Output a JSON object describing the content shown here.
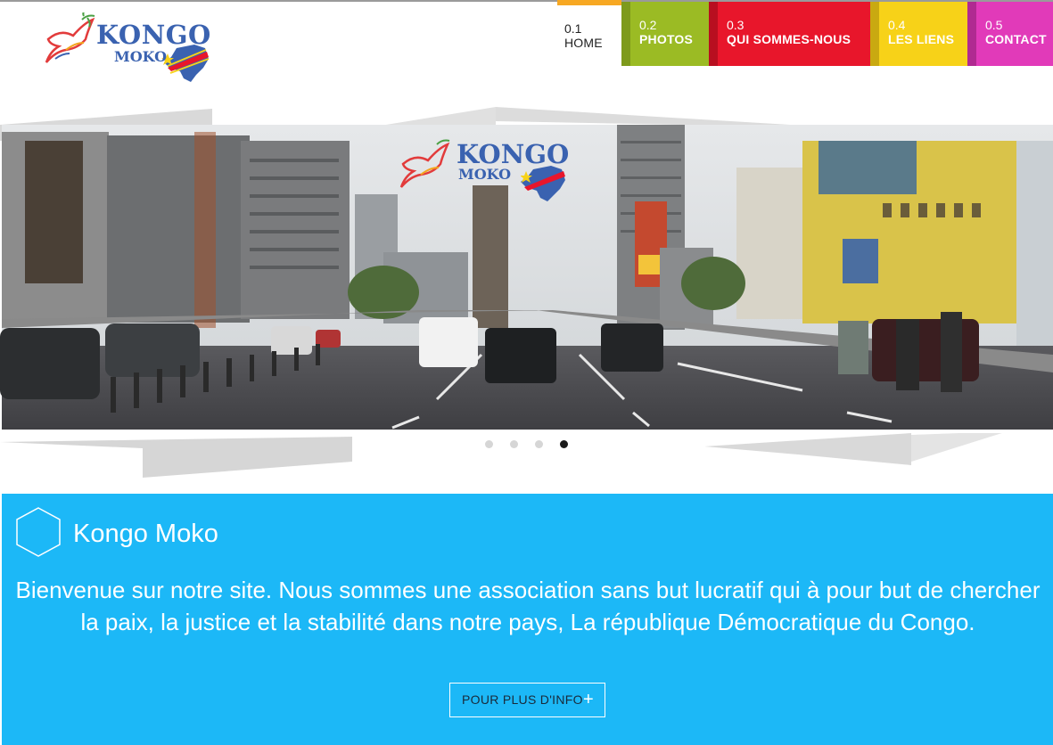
{
  "brand": {
    "name_line1": "KONGO",
    "name_line2": "MOKO"
  },
  "nav": [
    {
      "num": "0.1",
      "label": "HOME",
      "color": "#ffffff",
      "active": true
    },
    {
      "num": "0.2",
      "label": "PHOTOS",
      "color": "#9bbb24"
    },
    {
      "num": "0.3",
      "label": "QUI SOMMES-NOUS",
      "color": "#e8162b"
    },
    {
      "num": "0.4",
      "label": "LES LIENS",
      "color": "#f7d218"
    },
    {
      "num": "0.5",
      "label": "CONTACT",
      "color": "#e13ab9"
    }
  ],
  "slider": {
    "photo_logo_line1": "KONGO",
    "photo_logo_line2": "MOKO",
    "slide_count": 4,
    "active_slide": 4
  },
  "intro": {
    "title": "Kongo Moko",
    "text": "Bienvenue sur notre site. Nous sommes une association sans but lucratif qui à pour but de chercher la paix, la justice et la stabilité dans notre pays, La république Démocratique du Congo.",
    "button_label": "POUR PLUS D'INFO",
    "button_icon": "plus-icon",
    "accent_color": "#1cb8f7"
  }
}
